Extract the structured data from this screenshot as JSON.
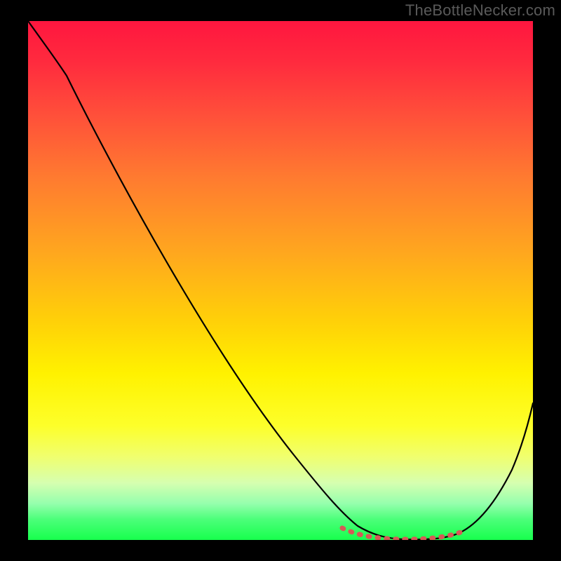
{
  "watermark": "TheBottleNecker.com",
  "chart_data": {
    "type": "line",
    "title": "",
    "xlabel": "",
    "ylabel": "",
    "xlim": [
      0,
      100
    ],
    "ylim": [
      0,
      100
    ],
    "series": [
      {
        "name": "bottleneck-curve",
        "x": [
          0,
          7,
          14,
          22,
          30,
          38,
          46,
          54,
          60,
          64,
          68,
          72,
          76,
          80,
          84,
          88,
          92,
          96,
          100
        ],
        "y": [
          100,
          93,
          85,
          75,
          64,
          53,
          42,
          31,
          22,
          15,
          9,
          4,
          1,
          0,
          1,
          5,
          12,
          20,
          30
        ]
      }
    ],
    "annotations": [
      {
        "name": "optimal-zone",
        "x_range": [
          62,
          87
        ],
        "y": 1,
        "style": "dotted-red"
      }
    ],
    "background": {
      "type": "vertical-gradient",
      "stops": [
        {
          "pos": 0.0,
          "color": "#ff163f"
        },
        {
          "pos": 0.5,
          "color": "#ffc400"
        },
        {
          "pos": 0.78,
          "color": "#fdff2a"
        },
        {
          "pos": 1.0,
          "color": "#17ff4d"
        }
      ]
    }
  }
}
